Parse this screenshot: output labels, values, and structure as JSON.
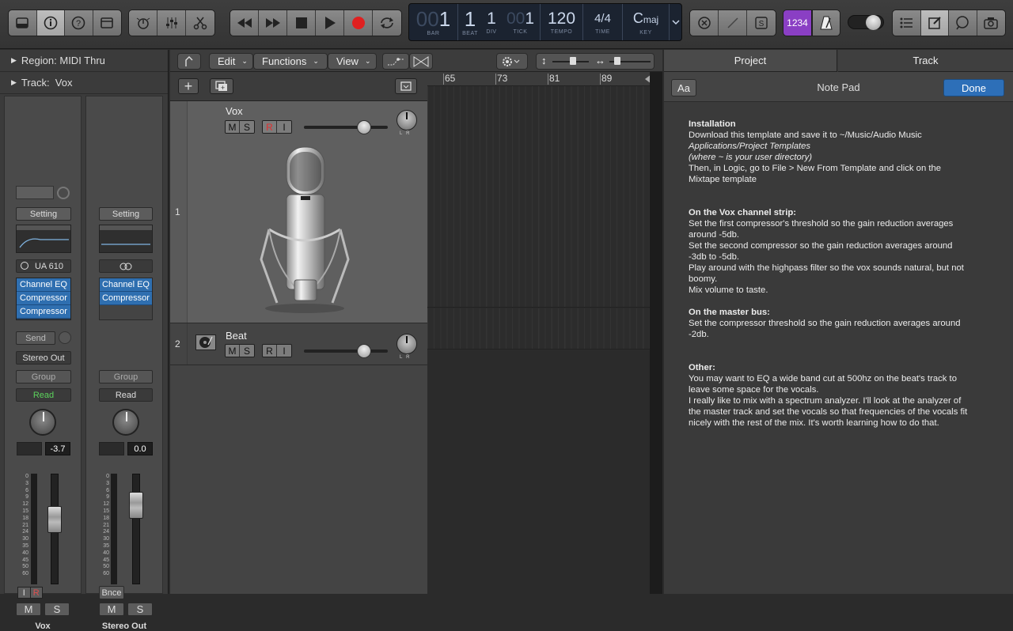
{
  "toolbar": {
    "library_icon": "library-icon",
    "inspector_icon": "info-icon",
    "help_icon": "help-icon",
    "toolbar_icon": "toolbar-toggle-icon",
    "smart_controls_icon": "smart-controls-icon",
    "mixer_icon": "mixer-icon",
    "editors_icon": "scissors-icon",
    "rewind_icon": "rewind-icon",
    "forward_icon": "fast-forward-icon",
    "stop_icon": "stop-icon",
    "play_icon": "play-icon",
    "record_icon": "record-icon",
    "cycle_icon": "cycle-icon",
    "lcd": {
      "bar_dim": "00",
      "bar": "1",
      "beat": "1",
      "div": "1",
      "tick_dim": "00",
      "tick": "1",
      "tempo": "120",
      "time_sig": "4/4",
      "key": "C",
      "key_mode": "maj",
      "bar_label": "BAR",
      "beat_label": "BEAT",
      "div_label": "DIV",
      "tick_label": "TICK",
      "tempo_label": "TEMPO",
      "time_label": "TIME",
      "key_label": "KEY"
    },
    "count_in": "1234",
    "metronome_icon": "metronome-icon",
    "list_icon": "list-editors-icon",
    "notepad_icon": "notepad-icon",
    "loop_icon": "loop-browser-icon",
    "browser_icon": "browser-icon"
  },
  "inspector": {
    "region_label": "Region:",
    "region_value": "MIDI Thru",
    "track_label": "Track:",
    "track_value": "Vox",
    "strips": [
      {
        "name": "Vox",
        "setting": "Setting",
        "input": "UA 610",
        "plugins": [
          "Channel EQ",
          "Compressor",
          "Compressor"
        ],
        "send": "Send",
        "output": "Stereo Out",
        "group": "Group",
        "automation": "Read",
        "volume": "-3.7",
        "input_mon": "I",
        "rec": "R",
        "mute": "M",
        "solo": "S"
      },
      {
        "name": "Stereo Out",
        "setting": "Setting",
        "plugins": [
          "Channel EQ",
          "Compressor"
        ],
        "group": "Group",
        "automation": "Read",
        "volume": "0.0",
        "bounce": "Bnce",
        "mute": "M",
        "solo": "S"
      }
    ],
    "scale": [
      "0",
      "3",
      "6",
      "9",
      "12",
      "15",
      "18",
      "21",
      "24",
      "30",
      "35",
      "40",
      "45",
      "50",
      "60"
    ]
  },
  "tracks_area": {
    "edit_menu": "Edit",
    "functions_menu": "Functions",
    "view_menu": "View",
    "ruler": [
      "65",
      "73",
      "81",
      "89",
      "9"
    ],
    "tracks": [
      {
        "number": "1",
        "name": "Vox",
        "mute": "M",
        "solo": "S",
        "rec": "R",
        "input": "I",
        "level": 0.72
      },
      {
        "number": "2",
        "name": "Beat",
        "mute": "M",
        "solo": "S",
        "rec": "R",
        "input": "I",
        "level": 0.72
      }
    ]
  },
  "notepad": {
    "tab_project": "Project",
    "tab_track": "Track",
    "font_button": "Aa",
    "title": "Note Pad",
    "done": "Done",
    "lines": [
      {
        "text": "Installation",
        "style": "b"
      },
      {
        "text": "Download this template and save it to ~/Music/Audio Music",
        "style": ""
      },
      {
        "text": "Applications/Project Templates",
        "style": "i"
      },
      {
        "text": "(where ~ is your user directory)",
        "style": "i"
      },
      {
        "text": "Then, in Logic, go to File > New From Template and click on the",
        "style": ""
      },
      {
        "text": "Mixtape template",
        "style": ""
      },
      {
        "text": "",
        "style": ""
      },
      {
        "text": "",
        "style": ""
      },
      {
        "text": "On the Vox channel strip:",
        "style": "b"
      },
      {
        "text": "Set the first compressor's threshold so the gain reduction averages",
        "style": ""
      },
      {
        "text": "around -5db.",
        "style": ""
      },
      {
        "text": "Set the second compressor so the gain reduction averages around",
        "style": ""
      },
      {
        "text": "-3db to -5db.",
        "style": ""
      },
      {
        "text": "Play around with the highpass filter so the vox sounds natural, but not",
        "style": ""
      },
      {
        "text": "boomy.",
        "style": ""
      },
      {
        "text": "Mix volume to taste.",
        "style": ""
      },
      {
        "text": "",
        "style": ""
      },
      {
        "text": "On the master bus:",
        "style": "b"
      },
      {
        "text": "Set the compressor threshold so the gain reduction averages around",
        "style": ""
      },
      {
        "text": "-2db.",
        "style": ""
      },
      {
        "text": "",
        "style": ""
      },
      {
        "text": "",
        "style": ""
      },
      {
        "text": "Other:",
        "style": "b"
      },
      {
        "text": "You may want to EQ a wide band cut at 500hz on the beat's track to",
        "style": ""
      },
      {
        "text": "leave some space for the vocals.",
        "style": ""
      },
      {
        "text": "I really like to mix with a spectrum analyzer. I'll look at the analyzer of",
        "style": ""
      },
      {
        "text": "the master track and set the vocals so that frequencies of the vocals fit",
        "style": ""
      },
      {
        "text": "nicely with the rest of the mix. It's worth learning how to do that.",
        "style": ""
      }
    ]
  }
}
